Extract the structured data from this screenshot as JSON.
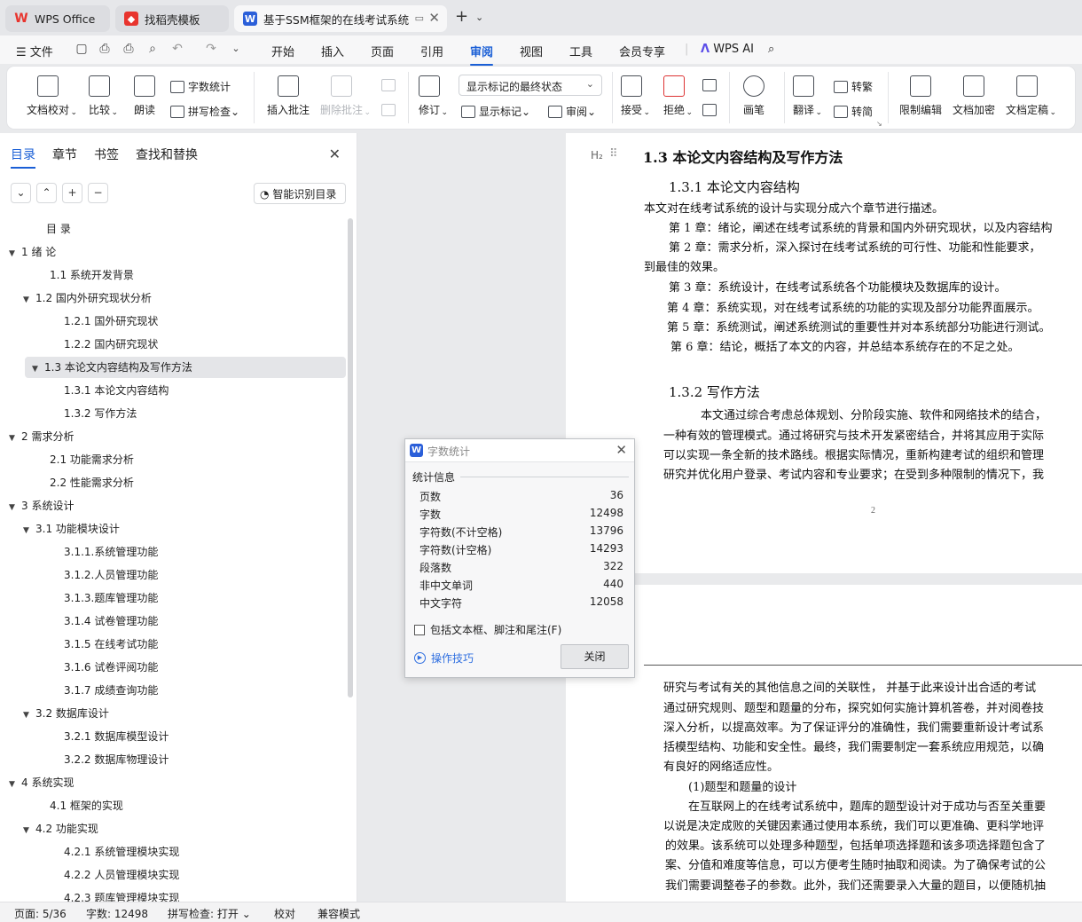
{
  "tabs": [
    {
      "label": "WPS Office",
      "icon": "wps-logo-icon"
    },
    {
      "label": "找稻壳模板",
      "icon": "docer-icon"
    },
    {
      "label": "基于SSM框架的在线考试系统",
      "icon": "wps-writer-icon"
    }
  ],
  "menu": {
    "file": "文件",
    "items": [
      "开始",
      "插入",
      "页面",
      "引用",
      "审阅",
      "视图",
      "工具",
      "会员专享"
    ],
    "active": "审阅",
    "ai": "WPS AI"
  },
  "ribbon": {
    "doc_check": "文档校对",
    "compare": "比较",
    "read_aloud": "朗读",
    "word_count": "字数统计",
    "spell_check": "拼写检查",
    "insert_comment": "插入批注",
    "delete_comment": "删除批注",
    "track": "修订",
    "markup_state": "显示标记的最终状态",
    "show_markup": "显示标记",
    "review_pane": "审阅",
    "accept": "接受",
    "reject": "拒绝",
    "pen": "画笔",
    "translate": "翻译",
    "to_traditional": "转繁",
    "to_simplified": "转简",
    "restrict": "限制编辑",
    "encrypt": "文档加密",
    "finalize": "文档定稿"
  },
  "nav": {
    "tabs": [
      "目录",
      "章节",
      "书签",
      "查找和替换"
    ],
    "active_tab": "目录",
    "smart_toc": "智能识别目录",
    "toc": [
      {
        "label": "目  录",
        "level": 0,
        "arrow": ""
      },
      {
        "label": "1 绪 论",
        "level": 0,
        "arrow": "▼"
      },
      {
        "label": "1.1  系统开发背景",
        "level": 1,
        "arrow": ""
      },
      {
        "label": "1.2  国内外研究现状分析",
        "level": 1,
        "arrow": "▼"
      },
      {
        "label": "1.2.1  国外研究现状",
        "level": 2,
        "arrow": ""
      },
      {
        "label": "1.2.2  国内研究现状",
        "level": 2,
        "arrow": ""
      },
      {
        "label": "1.3  本论文内容结构及写作方法",
        "level": 1,
        "arrow": "▼",
        "selected": true
      },
      {
        "label": "1.3.1  本论文内容结构",
        "level": 2,
        "arrow": ""
      },
      {
        "label": "1.3.2  写作方法",
        "level": 2,
        "arrow": ""
      },
      {
        "label": "2 需求分析",
        "level": 0,
        "arrow": "▼"
      },
      {
        "label": "2.1  功能需求分析",
        "level": 1,
        "arrow": ""
      },
      {
        "label": "2.2  性能需求分析",
        "level": 1,
        "arrow": ""
      },
      {
        "label": "3  系统设计",
        "level": 0,
        "arrow": "▼"
      },
      {
        "label": "3.1  功能模块设计",
        "level": 1,
        "arrow": "▼"
      },
      {
        "label": "3.1.1.系统管理功能",
        "level": 2,
        "arrow": ""
      },
      {
        "label": "3.1.2.人员管理功能",
        "level": 2,
        "arrow": ""
      },
      {
        "label": "3.1.3.题库管理功能",
        "level": 2,
        "arrow": ""
      },
      {
        "label": "3.1.4 试卷管理功能",
        "level": 2,
        "arrow": ""
      },
      {
        "label": "3.1.5 在线考试功能",
        "level": 2,
        "arrow": ""
      },
      {
        "label": "3.1.6 试卷评阅功能",
        "level": 2,
        "arrow": ""
      },
      {
        "label": "3.1.7 成绩查询功能",
        "level": 2,
        "arrow": ""
      },
      {
        "label": "3.2  数据库设计",
        "level": 1,
        "arrow": "▼"
      },
      {
        "label": "3.2.1  数据库模型设计",
        "level": 2,
        "arrow": ""
      },
      {
        "label": "3.2.2  数据库物理设计",
        "level": 2,
        "arrow": ""
      },
      {
        "label": "4  系统实现",
        "level": 0,
        "arrow": "▼"
      },
      {
        "label": "4.1  框架的实现",
        "level": 1,
        "arrow": ""
      },
      {
        "label": "4.2  功能实现",
        "level": 1,
        "arrow": "▼"
      },
      {
        "label": "4.2.1 系统管理模块实现",
        "level": 2,
        "arrow": ""
      },
      {
        "label": "4.2.2 人员管理模块实现",
        "level": 2,
        "arrow": ""
      },
      {
        "label": "4.2.3 题库管理模块实现",
        "level": 2,
        "arrow": ""
      }
    ]
  },
  "document": {
    "heading_marker": "H₂",
    "page1": [
      {
        "text": "1.3  本论文内容结构及写作方法",
        "cls": "h2"
      },
      {
        "text": "1.3.1  本论文内容结构",
        "cls": "h3"
      },
      {
        "text": "本文对在线考试系统的设计与实现分成六个章节进行描述。",
        "cls": ""
      },
      {
        "text": "第 1 章：绪论，阐述在线考试系统的背景和国内外研究现状，以及内容结构",
        "cls": ""
      },
      {
        "text": "第 2 章：需求分析，深入探讨在线考试系统的可行性、功能和性能要求，",
        "cls": ""
      },
      {
        "text": "到最佳的效果。",
        "cls": ""
      },
      {
        "text": "第 3 章：系统设计，在线考试系统各个功能模块及数据库的设计。",
        "cls": ""
      },
      {
        "text": "第 4 章：系统实现，对在线考试系统的功能的实现及部分功能界面展示。",
        "cls": ""
      },
      {
        "text": "第 5 章：系统测试，阐述系统测试的重要性并对本系统部分功能进行测试。",
        "cls": ""
      },
      {
        "text": "第 6 章：结论，概括了本文的内容，并总结本系统存在的不足之处。",
        "cls": ""
      },
      {
        "text": "1.3.2  写作方法",
        "cls": "h3"
      },
      {
        "text": "本文通过综合考虑总体规划、分阶段实施、软件和网络技术的结合，",
        "cls": ""
      },
      {
        "text": "一种有效的管理模式。通过将研究与技术开发紧密结合，并将其应用于实际",
        "cls": ""
      },
      {
        "text": "可以实现一条全新的技术路线。根据实际情况，重新构建考试的组织和管理",
        "cls": ""
      },
      {
        "text": "研究并优化用户登录、考试内容和专业要求；在受到多种限制的情况下，我",
        "cls": ""
      }
    ],
    "page_number": "2",
    "page2": [
      "研究与考试有关的其他信息之间的关联性，  并基于此来设计出合适的考试",
      "通过研究规则、题型和题量的分布，探究如何实施计算机答卷，并对阅卷技",
      "深入分析，以提高效率。为了保证评分的准确性，我们需要重新设计考试系",
      "括模型结构、功能和安全性。最终，我们需要制定一套系统应用规范，以确",
      "有良好的网络适应性。",
      "(1)题型和题量的设计",
      "在互联网上的在线考试系统中，题库的题型设计对于成功与否至关重要",
      "以说是决定成败的关键因素通过使用本系统，我们可以更准确、更科学地评",
      "的效果。该系统可以处理多种题型，包括单项选择题和该多项选择题包含了",
      "案、分值和难度等信息，可以方便考生随时抽取和阅读。为了确保考试的公",
      "我们需要调整卷子的参数。此外，我们还需要录入大量的题目，以便随机抽"
    ]
  },
  "dialog": {
    "title": "字数统计",
    "section": "统计信息",
    "rows": [
      {
        "label": "页数",
        "value": "36"
      },
      {
        "label": "字数",
        "value": "12498"
      },
      {
        "label": "字符数(不计空格)",
        "value": "13796"
      },
      {
        "label": "字符数(计空格)",
        "value": "14293"
      },
      {
        "label": "段落数",
        "value": "322"
      },
      {
        "label": "非中文单词",
        "value": "440"
      },
      {
        "label": "中文字符",
        "value": "12058"
      }
    ],
    "checkbox": "包括文本框、脚注和尾注(F)",
    "tips": "操作技巧",
    "close": "关闭"
  },
  "status": {
    "page": "页面: 5/36",
    "words": "字数: 12498",
    "spell": "拼写检查: 打开",
    "proof": "校对",
    "compat": "兼容模式"
  },
  "colors": {
    "accent": "#1a5fd6",
    "wps_red": "#e8342e",
    "writer_blue": "#2b5fd9"
  }
}
